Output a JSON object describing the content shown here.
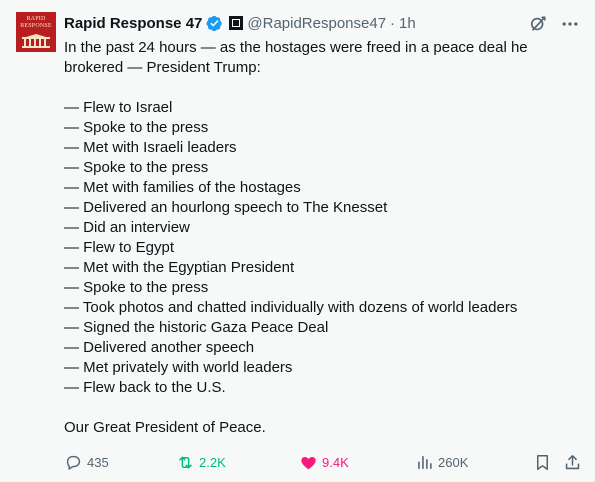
{
  "post": {
    "author": {
      "display_name": "Rapid Response 47",
      "handle": "@RapidResponse47",
      "verified_icon": "verified-badge-icon",
      "affiliate_icon": "government-affiliate-icon",
      "avatar_text_line1": "RAPID",
      "avatar_text_line2": "RESPONSE"
    },
    "separator": "·",
    "time": "1h",
    "top_icons": [
      "grok-icon",
      "more-icon"
    ],
    "intro": "In the past 24 hours — as the hostages were freed in a peace deal he brokered — President Trump:",
    "items": [
      "— Flew to Israel",
      "— Spoke to the press",
      "— Met with Israeli leaders",
      "— Spoke to the press",
      "— Met with families of the hostages",
      "— Delivered an hourlong speech to The Knesset",
      "— Did an interview",
      "— Flew to Egypt",
      "— Met with the Egyptian President",
      "— Spoke to the press",
      "— Took photos and chatted individually with dozens of world leaders",
      "— Signed the historic Gaza Peace Deal",
      "— Delivered another speech",
      "— Met privately with world leaders",
      "— Flew back to the U.S."
    ],
    "closing": "Our Great President of Peace."
  },
  "actions": {
    "replies": "435",
    "reposts": "2.2K",
    "likes": "9.4K",
    "views": "260K"
  },
  "colors": {
    "verified": "#1d9bf0",
    "repost_active": "#00ba7c",
    "like_active": "#f91880",
    "muted": "#536471",
    "avatar_bg": "#b81d20"
  }
}
